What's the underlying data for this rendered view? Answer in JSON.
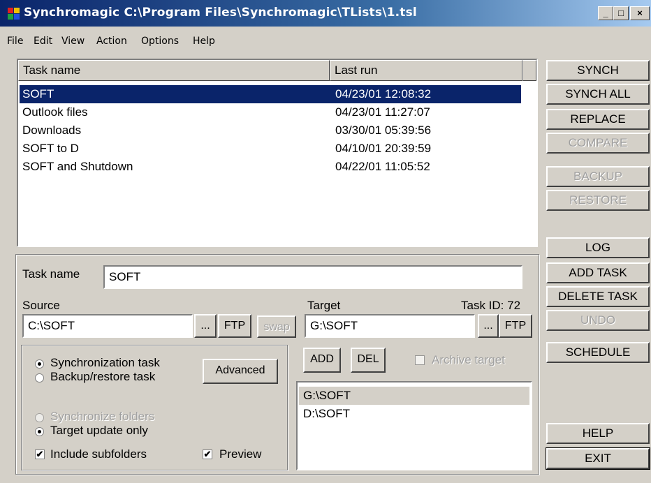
{
  "window": {
    "title": "Synchromagic C:\\Program Files\\Synchromagic\\TLists\\1.tsl",
    "min_glyph": "_",
    "max_glyph": "□",
    "close_glyph": "×"
  },
  "menu": [
    "File",
    "Edit",
    "View",
    "Action",
    "Options",
    "Help"
  ],
  "task_list": {
    "columns": [
      "Task name",
      "Last run"
    ],
    "rows": [
      {
        "name": "SOFT",
        "last_run": "04/23/01 12:08:32"
      },
      {
        "name": "Outlook files",
        "last_run": "04/23/01 11:27:07"
      },
      {
        "name": "Downloads",
        "last_run": "03/30/01 05:39:56"
      },
      {
        "name": "SOFT to D",
        "last_run": "04/10/01 20:39:59"
      },
      {
        "name": "SOFT and Shutdown",
        "last_run": "04/22/01 11:05:52"
      }
    ]
  },
  "side_buttons": {
    "synch": "SYNCH",
    "synch_all": "SYNCH ALL",
    "replace": "REPLACE",
    "compare": "COMPARE",
    "backup": "BACKUP",
    "restore": "RESTORE",
    "log": "LOG",
    "add_task": "ADD TASK",
    "delete_task": "DELETE TASK",
    "undo": "UNDO",
    "schedule": "SCHEDULE",
    "help": "HELP",
    "exit": "EXIT"
  },
  "form": {
    "task_name_label": "Task name",
    "task_name_value": "SOFT",
    "source_label": "Source",
    "source_value": "C:\\SOFT",
    "target_label": "Target",
    "task_id": "Task ID: 72",
    "target_value": "G:\\SOFT",
    "browse_label": "...",
    "ftp_label": "FTP",
    "swap_label": "swap",
    "add_label": "ADD",
    "del_label": "DEL",
    "archive_target": "Archive target",
    "sync_task": "Synchronization task",
    "backup_task": "Backup/restore task",
    "advanced": "Advanced",
    "sync_folders": "Synchronize folders",
    "target_update_only": "Target update only",
    "include_subfolders": "Include subfolders",
    "preview": "Preview",
    "check_glyph": "✔",
    "targets": [
      "G:\\SOFT",
      "D:\\SOFT"
    ]
  }
}
